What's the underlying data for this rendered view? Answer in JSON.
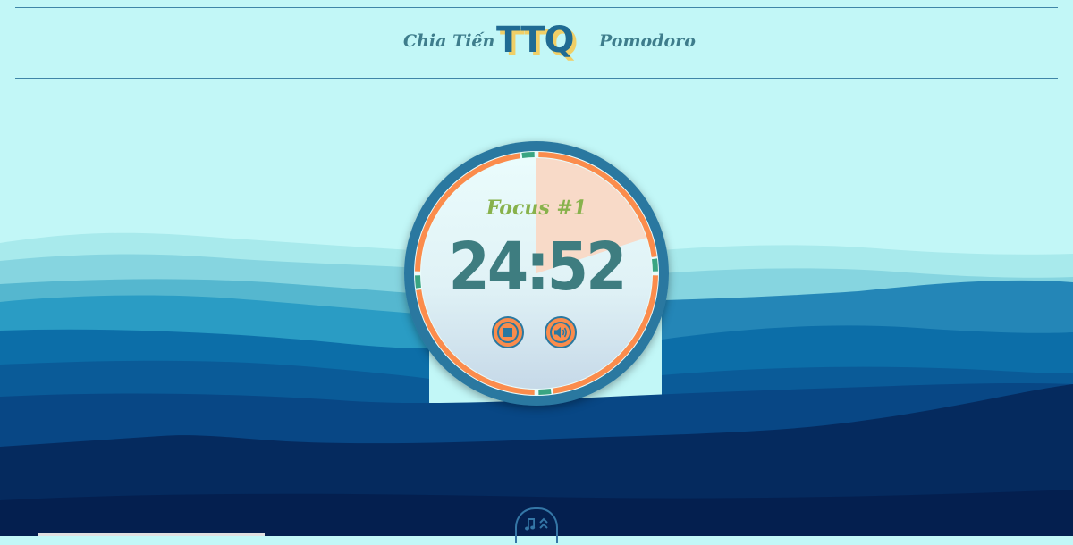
{
  "header": {
    "brand_left": "Chia Tiến",
    "logo": "TTQ",
    "brand_right": "Pomodoro"
  },
  "timer": {
    "session_label": "Focus #1",
    "time": "24:52",
    "progress": 0.2,
    "controls": {
      "stop_icon": "stop-icon",
      "sound_icon": "volume-icon"
    }
  },
  "music_toggle": {
    "icons": [
      "music-note-icon",
      "double-chevron-up-icon"
    ]
  },
  "colors": {
    "sky": "#c2f7f7",
    "ring_outer": "#2a78a0",
    "ring_focus": "#fb8c4c",
    "ring_break": "#3aa582",
    "progress_fill": "#f8dac8",
    "session_text": "#88b24c",
    "time_text": "#3e7d80",
    "logo": "#1f6b93",
    "logo_shadow": "#f0cf66"
  }
}
